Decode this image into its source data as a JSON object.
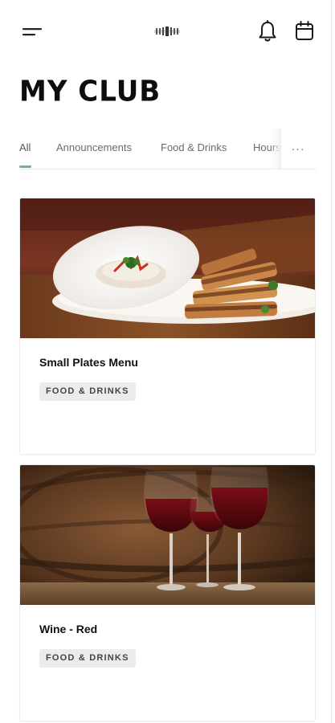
{
  "header": {
    "menu_icon": "hamburger-menu-icon",
    "logo_icon": "club-crest-logo",
    "notifications_icon": "bell-icon",
    "calendar_icon": "calendar-icon"
  },
  "page": {
    "title": "MY CLUB"
  },
  "tabs": {
    "items": [
      {
        "label": "All",
        "active": true
      },
      {
        "label": "Announcements",
        "active": false
      },
      {
        "label": "Food & Drinks",
        "active": false
      },
      {
        "label": "Hours",
        "active": false
      }
    ],
    "more_label": "···",
    "accent_color": "#7fa7a0"
  },
  "cards": [
    {
      "title": "Small Plates Menu",
      "tag": "FOOD & DRINKS",
      "image_icon": "small-plates-photo"
    },
    {
      "title": "Wine - Red",
      "tag": "FOOD & DRINKS",
      "image_icon": "red-wine-glasses-photo"
    }
  ]
}
